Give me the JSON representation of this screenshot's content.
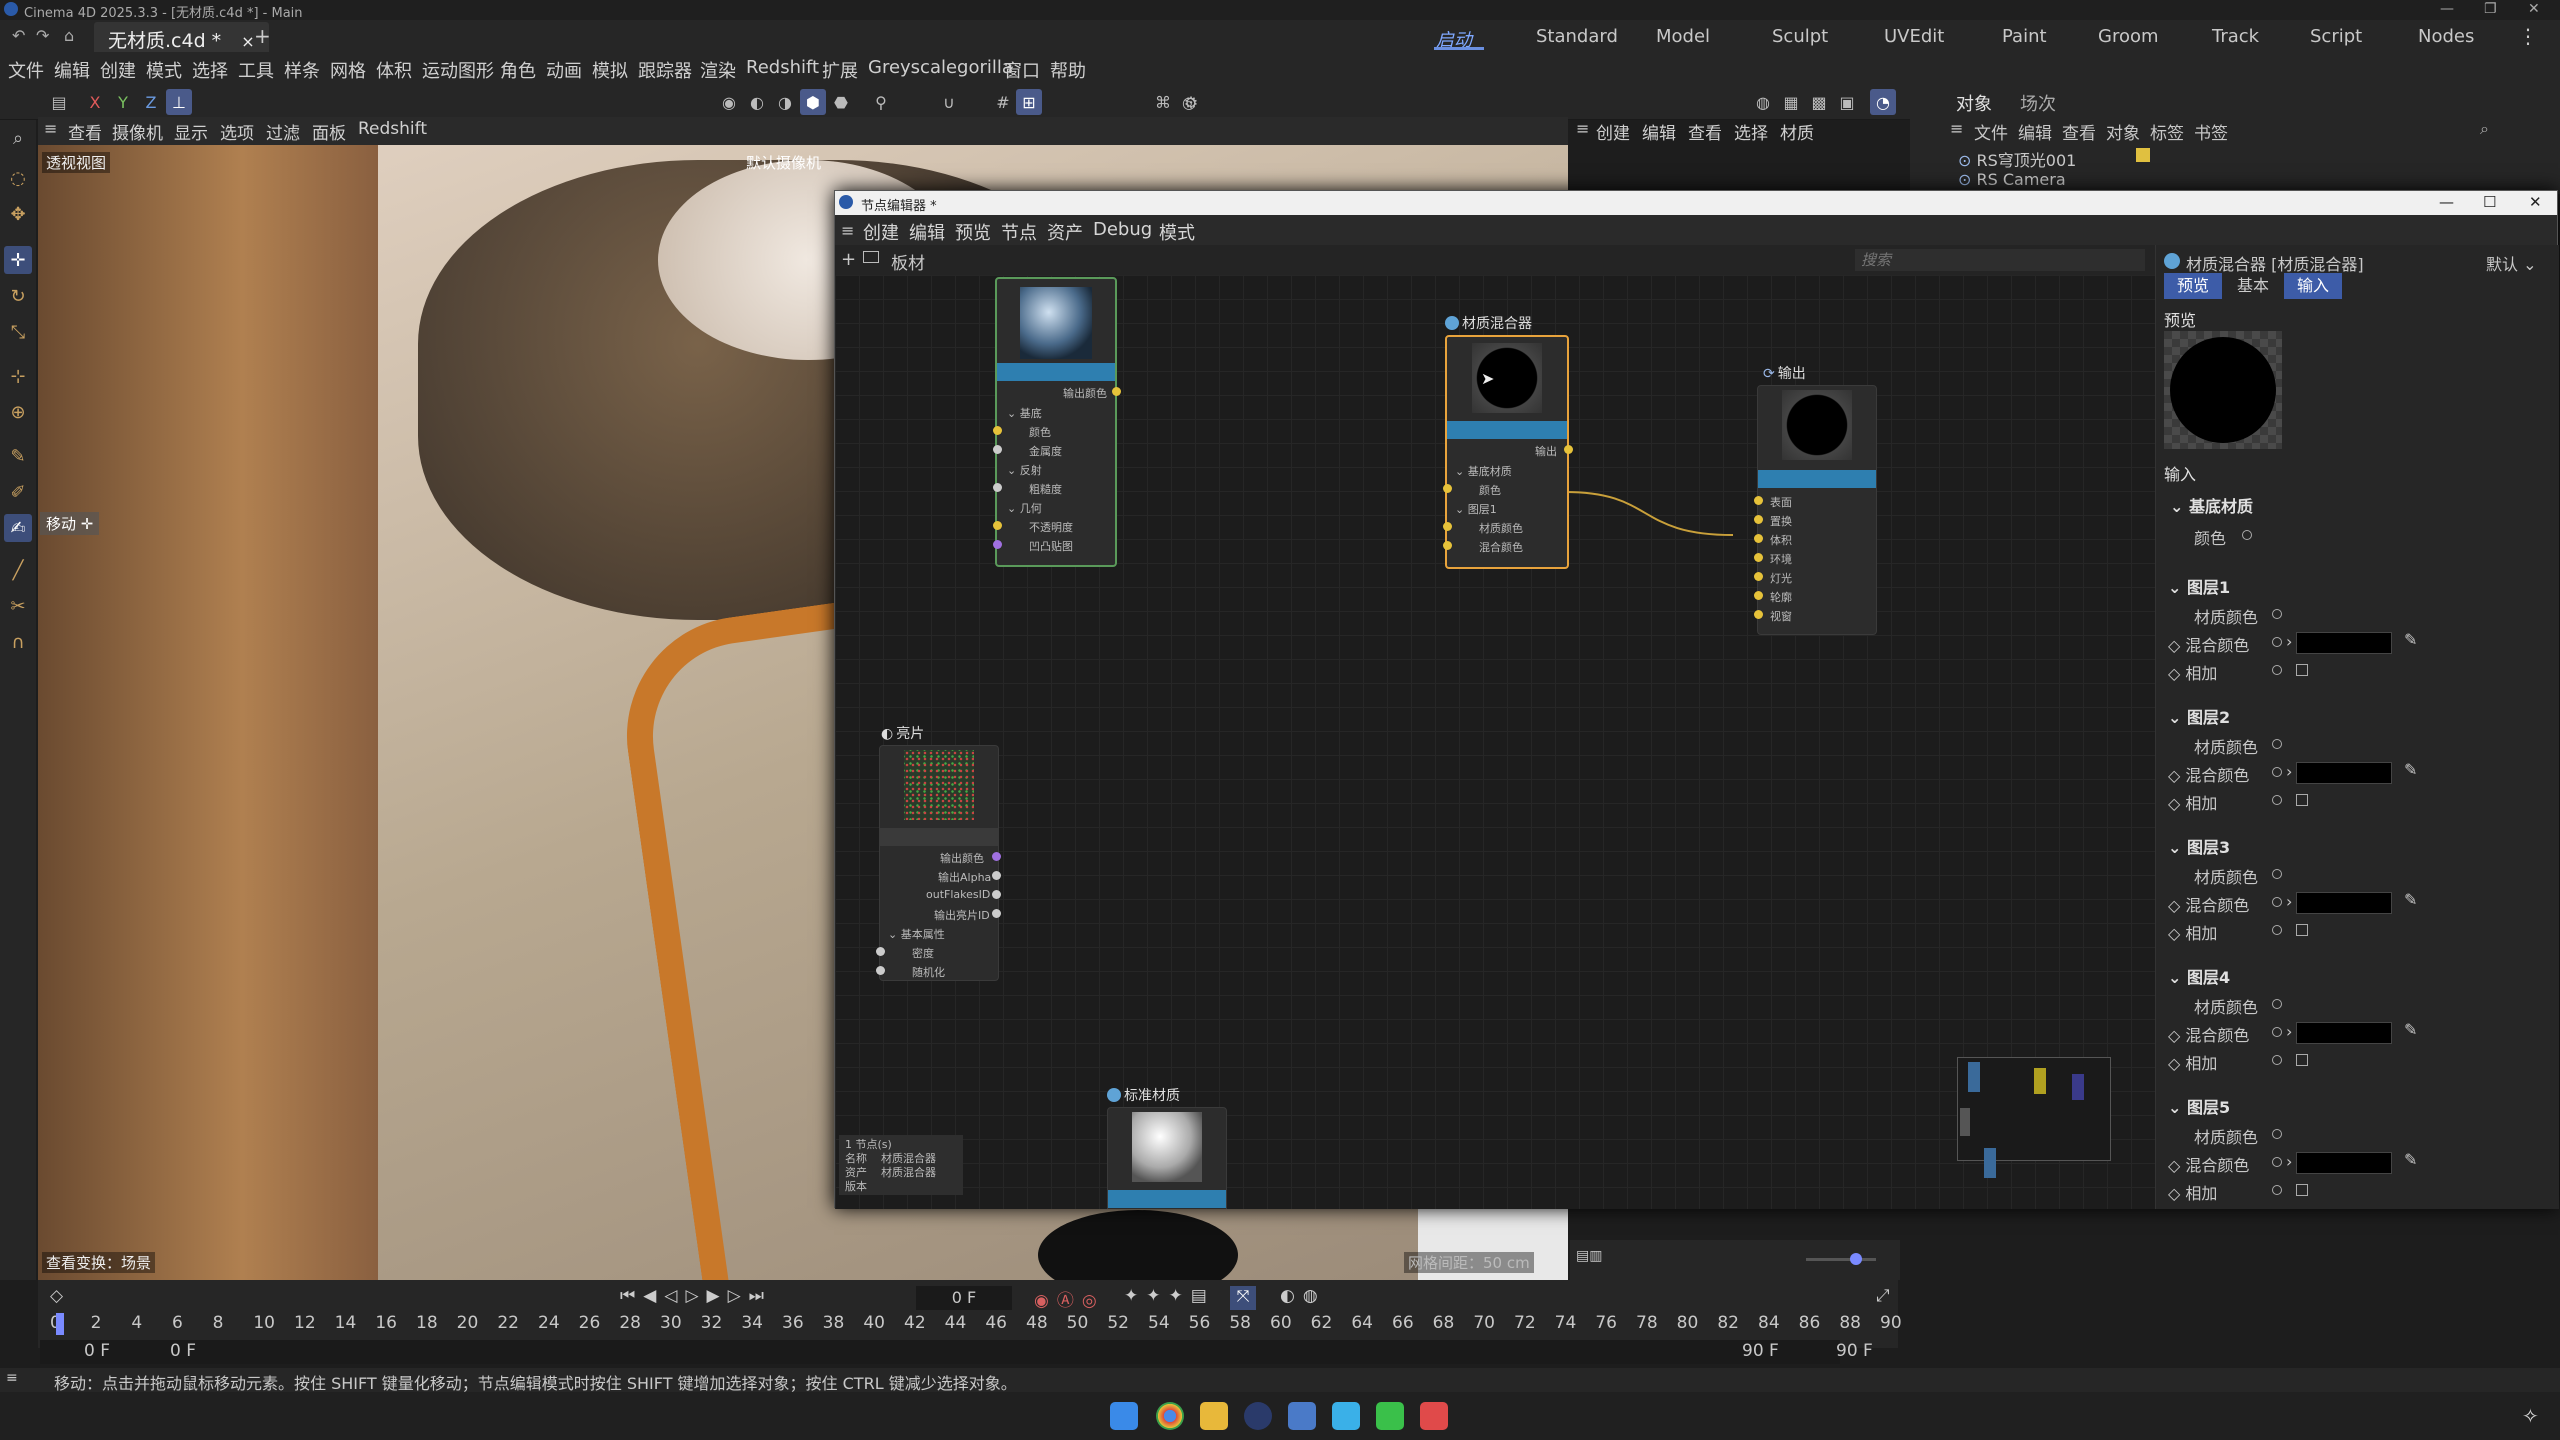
{
  "window": {
    "title": "Cinema 4D 2025.3.3 - [无材质.c4d *] - Main"
  },
  "tabs": {
    "doc": "无材质.c4d *",
    "close": "×",
    "add": "+"
  },
  "layouts": [
    "启动",
    "Standard",
    "Model",
    "Sculpt",
    "UVEdit",
    "Paint",
    "Groom",
    "Track",
    "Script",
    "Nodes"
  ],
  "menubar": [
    "文件",
    "编辑",
    "创建",
    "模式",
    "选择",
    "工具",
    "样条",
    "网格",
    "体积",
    "运动图形",
    "角色",
    "动画",
    "模拟",
    "跟踪器",
    "渲染",
    "Redshift",
    "扩展",
    "Greyscalegorilla",
    "窗口",
    "帮助"
  ],
  "axes": {
    "x": "X",
    "y": "Y",
    "z": "Z"
  },
  "viewport_menu": [
    "查看",
    "摄像机",
    "显示",
    "选项",
    "过滤",
    "面板",
    "Redshift"
  ],
  "viewport": {
    "label": "透视视图",
    "camera": "默认摄像机",
    "move_label": "移动",
    "view_transform": "查看变换：场景",
    "grid_spacing": "网格间距：50 cm"
  },
  "material_menu": [
    "创建",
    "编辑",
    "查看",
    "选择",
    "材质"
  ],
  "object_panel": {
    "tabs": [
      "对象",
      "场次"
    ],
    "menu": [
      "文件",
      "编辑",
      "查看",
      "对象",
      "标签",
      "书签"
    ],
    "items": [
      "RS穹顶光001",
      "RS Camera"
    ]
  },
  "node_editor": {
    "title": "节点编辑器 *",
    "menu": [
      "创建",
      "编辑",
      "预览",
      "节点",
      "资产",
      "Debug",
      "模式"
    ],
    "path": "板材",
    "search_placeholder": "搜索",
    "nodes": {
      "reflect": {
        "outputs": [
          "输出颜色"
        ],
        "groups": [
          "基底",
          "反射",
          "几何"
        ],
        "ports": [
          "颜色",
          "金属度",
          "粗糙度",
          "不透明度",
          "凹凸贴图"
        ]
      },
      "mixer": {
        "title": "材质混合器",
        "output": "输出",
        "groups": [
          "基底材质",
          "图层1"
        ],
        "ports": [
          "颜色",
          "材质颜色",
          "混合颜色"
        ]
      },
      "output": {
        "title": "输出",
        "ports": [
          "表面",
          "置换",
          "体积",
          "环境",
          "灯光",
          "轮廓",
          "视窗"
        ]
      },
      "flakes": {
        "title": "亮片",
        "outputs": [
          "输出颜色",
          "输出Alpha",
          "outFlakesID",
          "输出亮片ID"
        ],
        "group": "基本属性",
        "ports": [
          "密度",
          "随机化"
        ]
      },
      "standard": {
        "title": "标准材质"
      }
    },
    "info": {
      "count": "1 节点(s)",
      "name_label": "名称",
      "name": "材质混合器",
      "asset_label": "资产",
      "asset": "材质混合器",
      "version_label": "版本"
    }
  },
  "attributes": {
    "title": "材质混合器 [材质混合器]",
    "preset": "默认",
    "tabs": [
      "预览",
      "基本",
      "输入"
    ],
    "preview_label": "预览",
    "input_label": "输入",
    "base_group": "基底材质",
    "base_color": "颜色",
    "layers": [
      {
        "name": "图层1",
        "mat": "材质颜色",
        "mix": "混合颜色",
        "add": "相加"
      },
      {
        "name": "图层2",
        "mat": "材质颜色",
        "mix": "混合颜色",
        "add": "相加"
      },
      {
        "name": "图层3",
        "mat": "材质颜色",
        "mix": "混合颜色",
        "add": "相加"
      },
      {
        "name": "图层4",
        "mat": "材质颜色",
        "mix": "混合颜色",
        "add": "相加"
      },
      {
        "name": "图层5",
        "mat": "材质颜色",
        "mix": "混合颜色",
        "add": "相加"
      }
    ]
  },
  "timeline": {
    "frame": "0 F",
    "ticks": [
      "0",
      "2",
      "4",
      "6",
      "8",
      "10",
      "12",
      "14",
      "16",
      "18",
      "20",
      "22",
      "24",
      "26",
      "28",
      "30",
      "32",
      "34",
      "36",
      "38",
      "40",
      "42",
      "44",
      "46",
      "48",
      "50",
      "52",
      "54",
      "56",
      "58",
      "60",
      "62",
      "64",
      "66",
      "68",
      "70",
      "72",
      "74",
      "76",
      "78",
      "80",
      "82",
      "84",
      "86",
      "88",
      "90"
    ],
    "start": "0 F",
    "start2": "0 F",
    "end": "90 F",
    "end2": "90 F"
  },
  "status": "移动：点击并拖动鼠标移动元素。按住 SHIFT 键量化移动；节点编辑模式时按住 SHIFT 键增加选择对象；按住 CTRL 键减少选择对象。",
  "colors": {
    "accent": "#4a6aaa",
    "selected_node": "#e8a33c",
    "port_yellow": "#e6c23a",
    "node_header": "#2e7fb0"
  }
}
